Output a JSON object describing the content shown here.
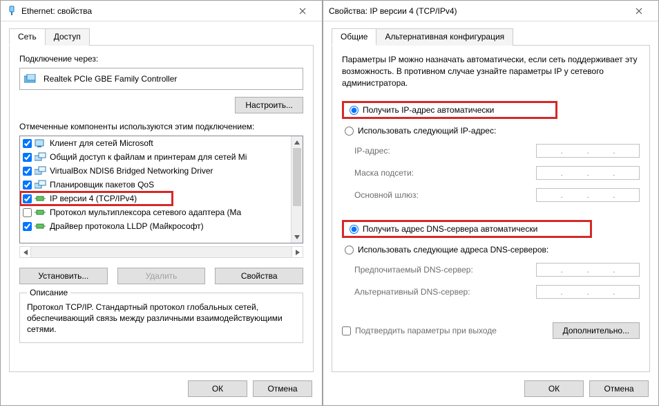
{
  "left": {
    "title": "Ethernet: свойства",
    "tabs": {
      "network": "Сеть",
      "access": "Доступ"
    },
    "connectVia": "Подключение через:",
    "controller": "Realtek PCIe GBE Family Controller",
    "configureBtn": "Настроить...",
    "componentsLabel": "Отмеченные компоненты используются этим подключением:",
    "items": [
      {
        "checked": true,
        "label": "Клиент для сетей Microsoft",
        "icon": "client"
      },
      {
        "checked": true,
        "label": "Общий доступ к файлам и принтерам для сетей Mi",
        "icon": "share"
      },
      {
        "checked": true,
        "label": "VirtualBox NDIS6 Bridged Networking Driver",
        "icon": "share"
      },
      {
        "checked": true,
        "label": "Планировщик пакетов QoS",
        "icon": "share"
      },
      {
        "checked": true,
        "label": "IP версии 4 (TCP/IPv4)",
        "icon": "proto",
        "hl": true
      },
      {
        "checked": false,
        "label": "Протокол мультиплексора сетевого адаптера (Ma",
        "icon": "proto"
      },
      {
        "checked": true,
        "label": "Драйвер протокола LLDP (Майкрософт)",
        "icon": "proto"
      }
    ],
    "installBtn": "Установить...",
    "removeBtn": "Удалить",
    "propsBtn": "Свойства",
    "descLegend": "Описание",
    "descText": "Протокол TCP/IP. Стандартный протокол глобальных сетей, обеспечивающий связь между различными взаимодействующими сетями.",
    "ok": "ОК",
    "cancel": "Отмена"
  },
  "right": {
    "title": "Свойства: IP версии 4 (TCP/IPv4)",
    "tabs": {
      "general": "Общие",
      "alt": "Альтернативная конфигурация"
    },
    "info": "Параметры IP можно назначать автоматически, если сеть поддерживает эту возможность. В противном случае узнайте параметры IP у сетевого администратора.",
    "ipAuto": "Получить IP-адрес автоматически",
    "ipManual": "Использовать следующий IP-адрес:",
    "ipAddr": "IP-адрес:",
    "mask": "Маска подсети:",
    "gateway": "Основной шлюз:",
    "dnsAuto": "Получить адрес DNS-сервера автоматически",
    "dnsManual": "Использовать следующие адреса DNS-серверов:",
    "dnsPref": "Предпочитаемый DNS-сервер:",
    "dnsAlt": "Альтернативный DNS-сервер:",
    "confirm": "Подтвердить параметры при выходе",
    "advanced": "Дополнительно...",
    "ok": "ОК",
    "cancel": "Отмена"
  }
}
